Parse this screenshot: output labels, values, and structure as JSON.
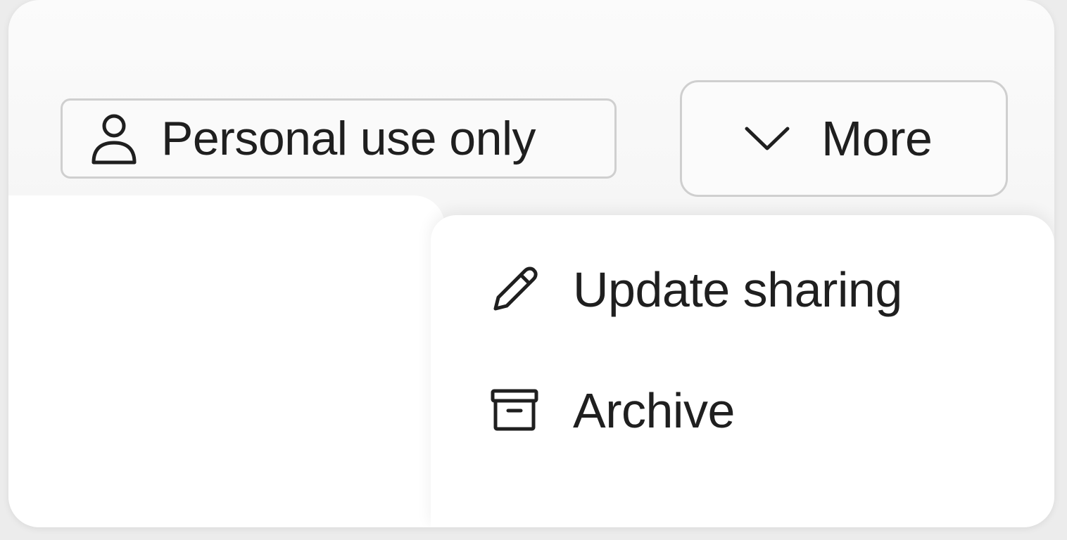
{
  "badge": {
    "label": "Personal use only",
    "icon": "person-icon"
  },
  "more_button": {
    "label": "More",
    "icon": "chevron-down-icon"
  },
  "menu": {
    "items": [
      {
        "label": "Update sharing",
        "icon": "pencil-icon"
      },
      {
        "label": "Archive",
        "icon": "archive-box-icon"
      }
    ]
  },
  "colors": {
    "text": "#1f1f1f",
    "border": "#cfcfcf",
    "card_background": "#f6f6f6",
    "menu_background": "#ffffff"
  }
}
